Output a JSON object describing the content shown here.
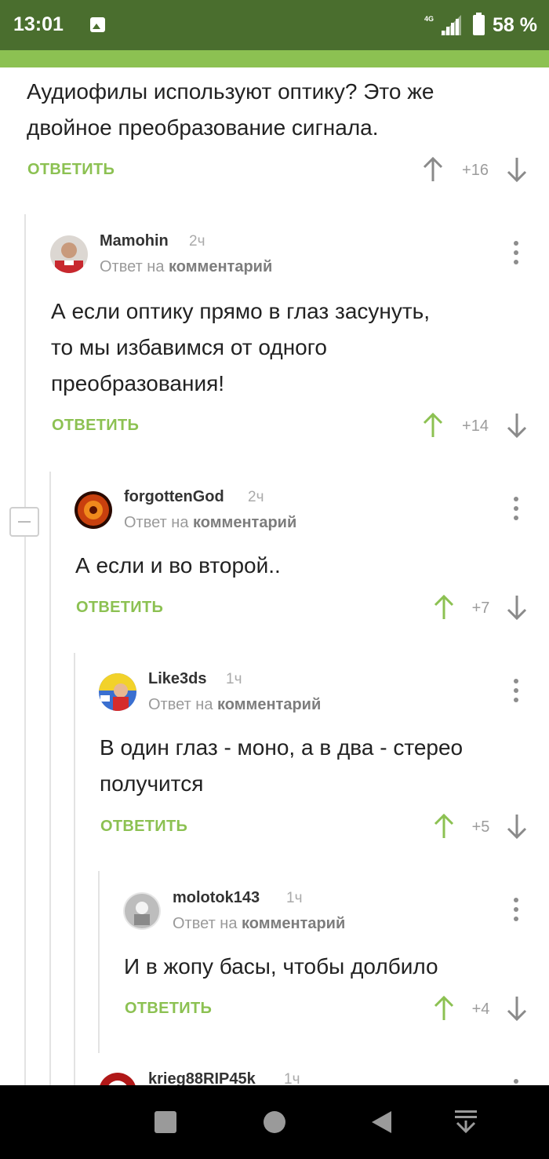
{
  "status": {
    "time": "13:01",
    "network": "4G",
    "battery": "58 %"
  },
  "top_comment": {
    "text_lines": [
      "Аудиофилы используют оптику? Это же",
      "двойное преобразование сигнала."
    ],
    "reply_label": "ОТВЕТИТЬ",
    "rating": "+16"
  },
  "comments": [
    {
      "author": "Mamohin",
      "age": "2ч",
      "reply_to_prefix": "Ответ на",
      "reply_to_link": "комментарий",
      "text_lines": [
        "А если оптику прямо в глаз засунуть,",
        "то мы избавимся от одного",
        "преобразования!"
      ],
      "reply_label": "ОТВЕТИТЬ",
      "rating": "+14"
    },
    {
      "author": "forgottenGod",
      "age": "2ч",
      "reply_to_prefix": "Ответ на",
      "reply_to_link": "комментарий",
      "text_lines": [
        "А если и во второй.."
      ],
      "reply_label": "ОТВЕТИТЬ",
      "rating": "+7"
    },
    {
      "author": "Like3ds",
      "age": "1ч",
      "reply_to_prefix": "Ответ на",
      "reply_to_link": "комментарий",
      "text_lines": [
        "В один глаз - моно, а в два - стерео",
        "получится"
      ],
      "reply_label": "ОТВЕТИТЬ",
      "rating": "+5"
    },
    {
      "author": "molotok143",
      "age": "1ч",
      "reply_to_prefix": "Ответ на",
      "reply_to_link": "комментарий",
      "text_lines": [
        "И в жопу басы, чтобы долбило"
      ],
      "reply_label": "ОТВЕТИТЬ",
      "rating": "+4"
    },
    {
      "author": "krieg88RIP45k",
      "age": "1ч"
    }
  ],
  "colors": {
    "statusbar": "#4a6e2e",
    "accent": "#8cc152",
    "upvote": "#8cc152",
    "downvote": "#8a8a8a"
  },
  "icons": [
    "image-icon",
    "signal-icon",
    "battery-icon",
    "upvote-arrow-icon",
    "downvote-arrow-icon",
    "more-vertical-icon",
    "collapse-icon",
    "nav-square-icon",
    "nav-circle-icon",
    "nav-back-icon",
    "nav-menu-icon"
  ]
}
